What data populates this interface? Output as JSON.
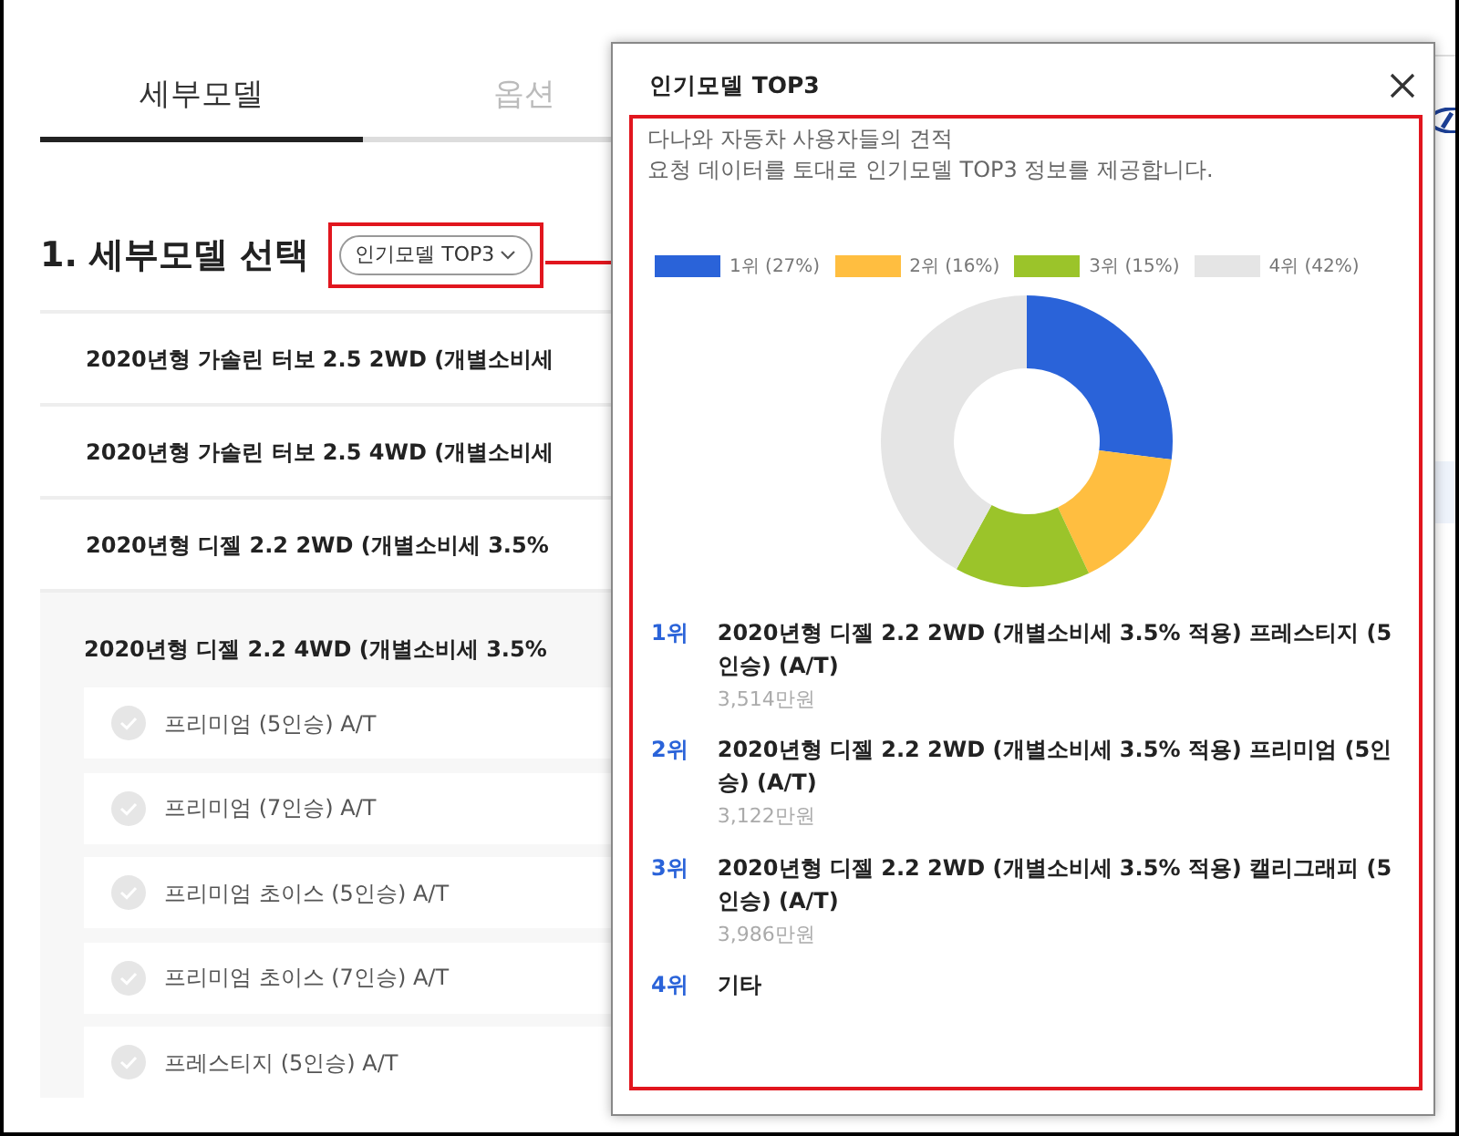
{
  "tabs": [
    {
      "label": "세부모델",
      "selected": true
    },
    {
      "label": "옵션",
      "selected": false
    }
  ],
  "section": {
    "title": "1. 세부모델 선택",
    "popular_button": "인기모델 TOP3"
  },
  "models": [
    {
      "name": "2020년형 가솔린 터보 2.5 2WD (개별소비세",
      "expanded": false
    },
    {
      "name": "2020년형 가솔린 터보 2.5 4WD (개별소비세",
      "expanded": false
    },
    {
      "name": "2020년형 디젤 2.2 2WD (개별소비세 3.5%",
      "expanded": false
    },
    {
      "name": "2020년형 디젤 2.2 4WD (개별소비세 3.5%",
      "expanded": true,
      "trims": [
        {
          "name": "프리미엄 (5인승) A/T",
          "checked": false
        },
        {
          "name": "프리미엄 (7인승) A/T",
          "checked": false
        },
        {
          "name": "프리미엄 초이스 (5인승) A/T",
          "checked": false
        },
        {
          "name": "프리미엄 초이스 (7인승) A/T",
          "checked": false
        },
        {
          "name": "프레스티지 (5인승) A/T",
          "checked": false
        }
      ]
    }
  ],
  "modal": {
    "title": "인기모델 TOP3",
    "description": [
      "다나와 자동차 사용자들의 견적",
      "요청 데이터를 토대로 인기모델 TOP3 정보를 제공합니다."
    ],
    "chart": {
      "slices": [
        {
          "color": "#2a63d9"
        },
        {
          "color": "#ffbe40"
        },
        {
          "color": "#9bc42a"
        },
        {
          "color": "#e5e5e5"
        }
      ],
      "chart_data": {
        "type": "donut",
        "categories": [
          "1위 (27%)",
          "2위 (16%)",
          "3위 (15%)",
          "4위 (42%)"
        ],
        "values": [
          27,
          16,
          15,
          42
        ]
      }
    },
    "ranking": [
      {
        "rank": "1위",
        "name": "2020년형 디젤 2.2 2WD (개별소비세 3.5% 적용) 프레스티지 (5인승) (A/T)",
        "price": "3,514만원"
      },
      {
        "rank": "2위",
        "name": "2020년형 디젤 2.2 2WD (개별소비세 3.5% 적용) 프리미엄 (5인승) (A/T)",
        "price": "3,122만원"
      },
      {
        "rank": "3위",
        "name": "2020년형 디젤 2.2 2WD (개별소비세 3.5% 적용) 캘리그래피 (5인승) (A/T)",
        "price": "3,986만원"
      },
      {
        "rank": "4위",
        "name": "기타"
      }
    ]
  }
}
